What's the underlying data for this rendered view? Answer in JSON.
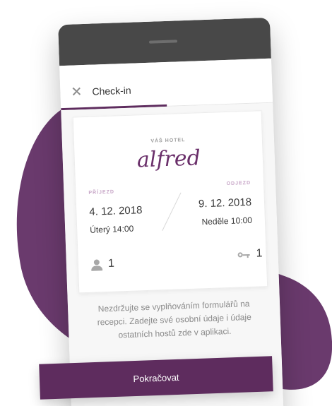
{
  "app": {
    "screen_title": "Check-in"
  },
  "hotel": {
    "label": "VÁŠ HOTEL",
    "name": "alfred"
  },
  "arrival": {
    "label": "PŘÍJEZD",
    "date": "4. 12. 2018",
    "time": "Úterý 14:00"
  },
  "departure": {
    "label": "ODJEZD",
    "date": "9. 12. 2018",
    "time": "Neděle 10:00"
  },
  "guests": {
    "count": "1",
    "icon": "person-icon"
  },
  "keys": {
    "count": "1",
    "icon": "key-icon"
  },
  "message": "Nezdržujte se vyplňováním formulářů na recepci. Zadejte své osobní údaje i údaje ostatních hostů zde v aplikaci.",
  "actions": {
    "continue_label": "Pokračovat"
  },
  "colors": {
    "accent": "#5e2c5e",
    "phone_frame": "#484848",
    "blob": "#6a3a6d"
  }
}
